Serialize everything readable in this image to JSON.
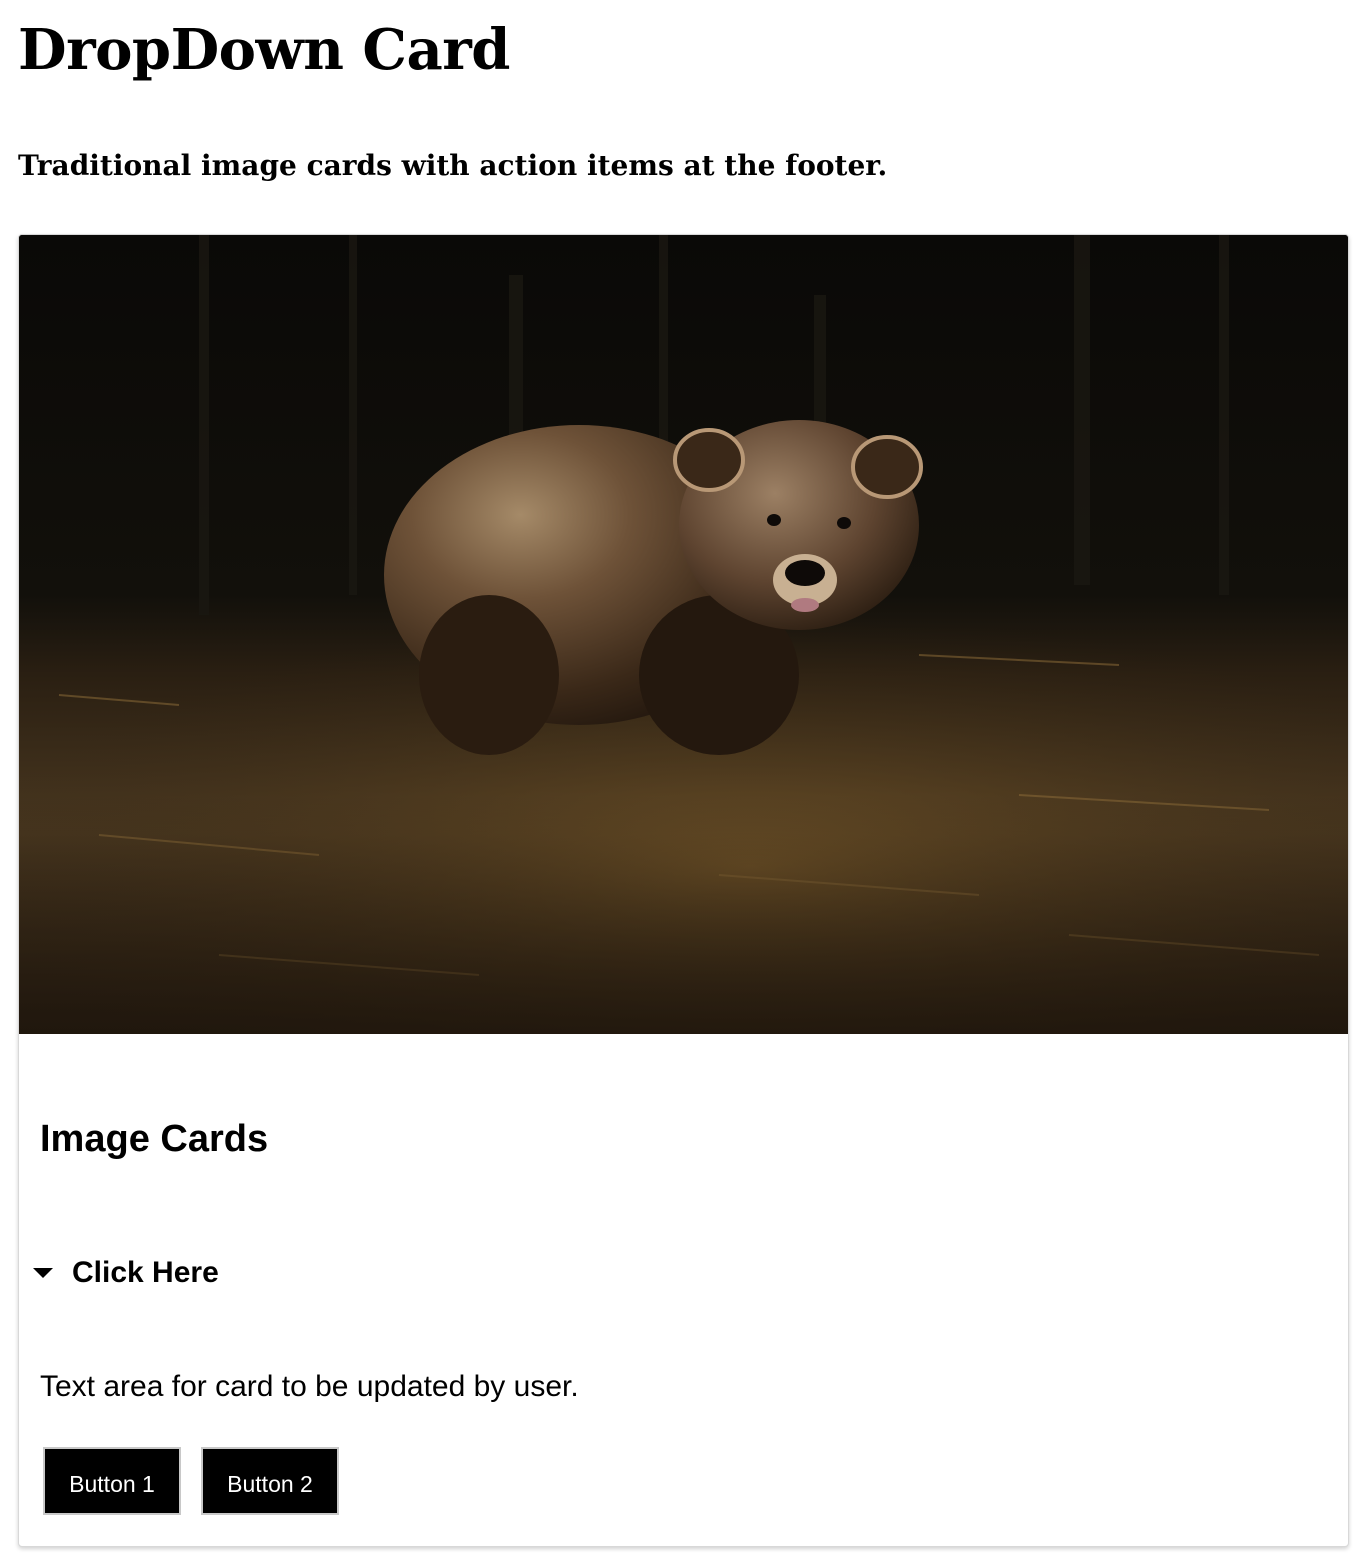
{
  "header": {
    "title": "DropDown Card",
    "subtitle": "Traditional image cards with action items at the footer."
  },
  "card": {
    "image_name": "brown-bear-photo",
    "title": "Image Cards",
    "dropdown": {
      "label": "Click Here",
      "icon": "caret-down-icon",
      "expanded": true
    },
    "text": "Text area for card to be updated by user.",
    "buttons": [
      {
        "label": "Button 1"
      },
      {
        "label": "Button 2"
      }
    ]
  },
  "colors": {
    "button_bg": "#000000",
    "button_text": "#ffffff",
    "card_border": "#d8d8d8"
  }
}
